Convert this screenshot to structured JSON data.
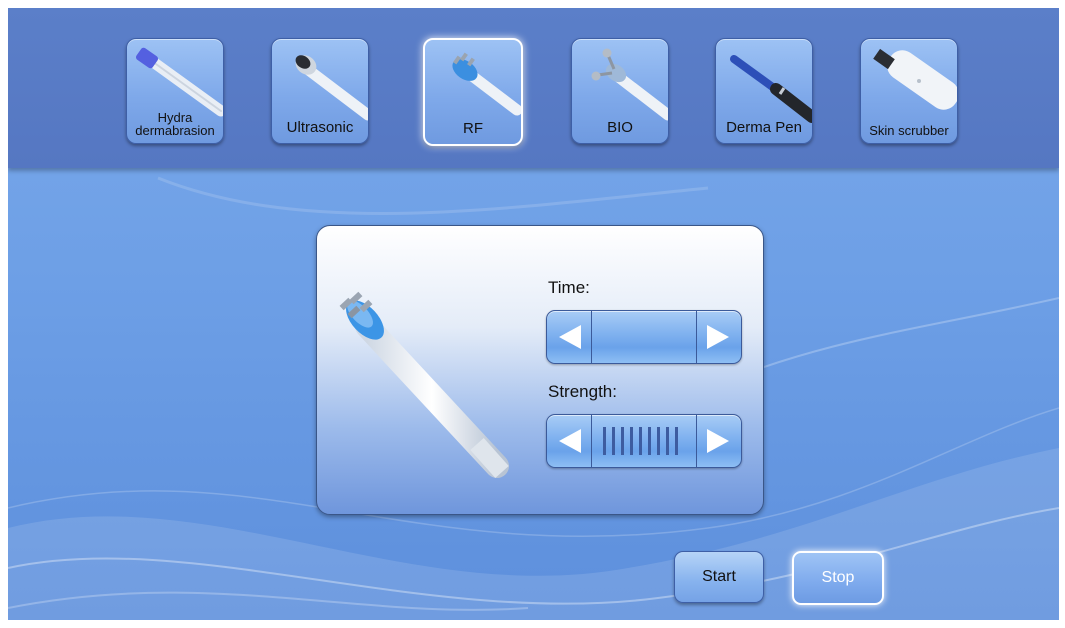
{
  "modes": [
    {
      "label": "Hydra dermabrasion",
      "icon": "hydra-dermabrasion-handpiece-icon",
      "selected": false
    },
    {
      "label": "Ultrasonic",
      "icon": "ultrasonic-handpiece-icon",
      "selected": false
    },
    {
      "label": "RF",
      "icon": "rf-handpiece-icon",
      "selected": true
    },
    {
      "label": "BIO",
      "icon": "bio-handpiece-icon",
      "selected": false
    },
    {
      "label": "Derma Pen",
      "icon": "derma-pen-icon",
      "selected": false
    },
    {
      "label": "Skin scrubber",
      "icon": "skin-scrubber-icon",
      "selected": false
    }
  ],
  "panel": {
    "device_icon": "rf-handpiece-icon",
    "time": {
      "label": "Time:",
      "value": ""
    },
    "strength": {
      "label": "Strength:",
      "level_bars": 9
    }
  },
  "actions": {
    "start_label": "Start",
    "stop_label": "Stop"
  },
  "colors": {
    "accent": "#6d9fe6",
    "top_bar": "#5779c3",
    "selected_border": "#ffffff"
  }
}
